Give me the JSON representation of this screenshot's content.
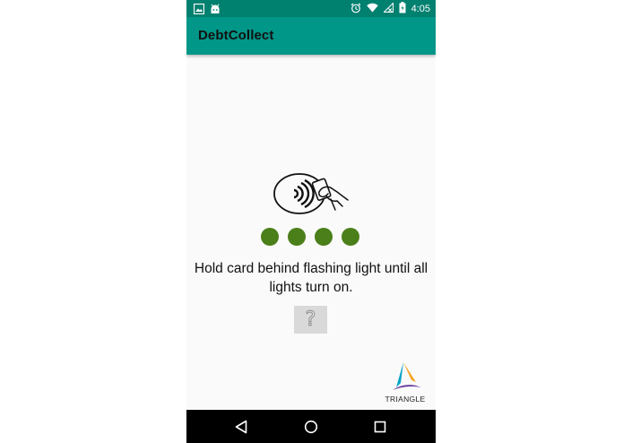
{
  "status_bar": {
    "time": "4:05",
    "icons": [
      "image-icon",
      "android-icon",
      "alarm-icon",
      "wifi-icon",
      "no-signal-icon",
      "battery-icon"
    ]
  },
  "app_bar": {
    "title": "DebtCollect"
  },
  "main": {
    "illustration": "contactless-card-icon",
    "indicator_lights": [
      {
        "state": "on",
        "color": "#4b7f1a"
      },
      {
        "state": "on",
        "color": "#4b7f1a"
      },
      {
        "state": "on",
        "color": "#4b7f1a"
      },
      {
        "state": "on",
        "color": "#4b7f1a"
      }
    ],
    "instruction_text": "Hold card behind flashing light until all lights turn on.",
    "help_button_label": "?"
  },
  "branding": {
    "name": "TRIANGLE",
    "colors": [
      "#00a3c4",
      "#f5a623",
      "#6b3fa0"
    ]
  },
  "nav_bar": {
    "buttons": [
      "back-icon",
      "home-icon",
      "recents-icon"
    ]
  },
  "colors": {
    "accent": "#009688",
    "status_bar": "#00806f",
    "background": "#fafafa",
    "light_on": "#4b7f1a"
  }
}
